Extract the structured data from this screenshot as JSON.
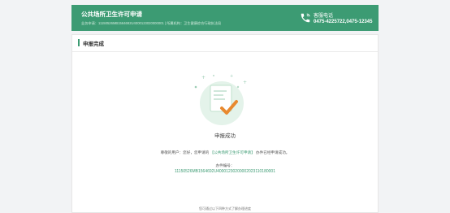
{
  "header": {
    "title": "公共场所卫生许可申请",
    "subtitle": "业务申请：11150526MB1564692U4000123020000001 | 所属机构：卫生健康综合行政执法局",
    "service_label": "客服电话",
    "service_phone": "0475-4225722,0475-12345"
  },
  "card": {
    "title": "申报完成"
  },
  "result": {
    "title": "申报成功",
    "message_prefix": "尊敬的用户：您好，您申请的",
    "message_highlight": "【公共场所卫生许可申请】",
    "message_suffix": "办件已经申请成功。",
    "code_label": "办件编号：",
    "code_value": "11150526MB1564692U40001230200002023110180001"
  },
  "footer": {
    "note": "您可通过以下四种方式了解办理进度"
  },
  "colors": {
    "brand": "#3c9b73",
    "check": "#e8892f",
    "illustration_bg": "#e4f3ea"
  }
}
